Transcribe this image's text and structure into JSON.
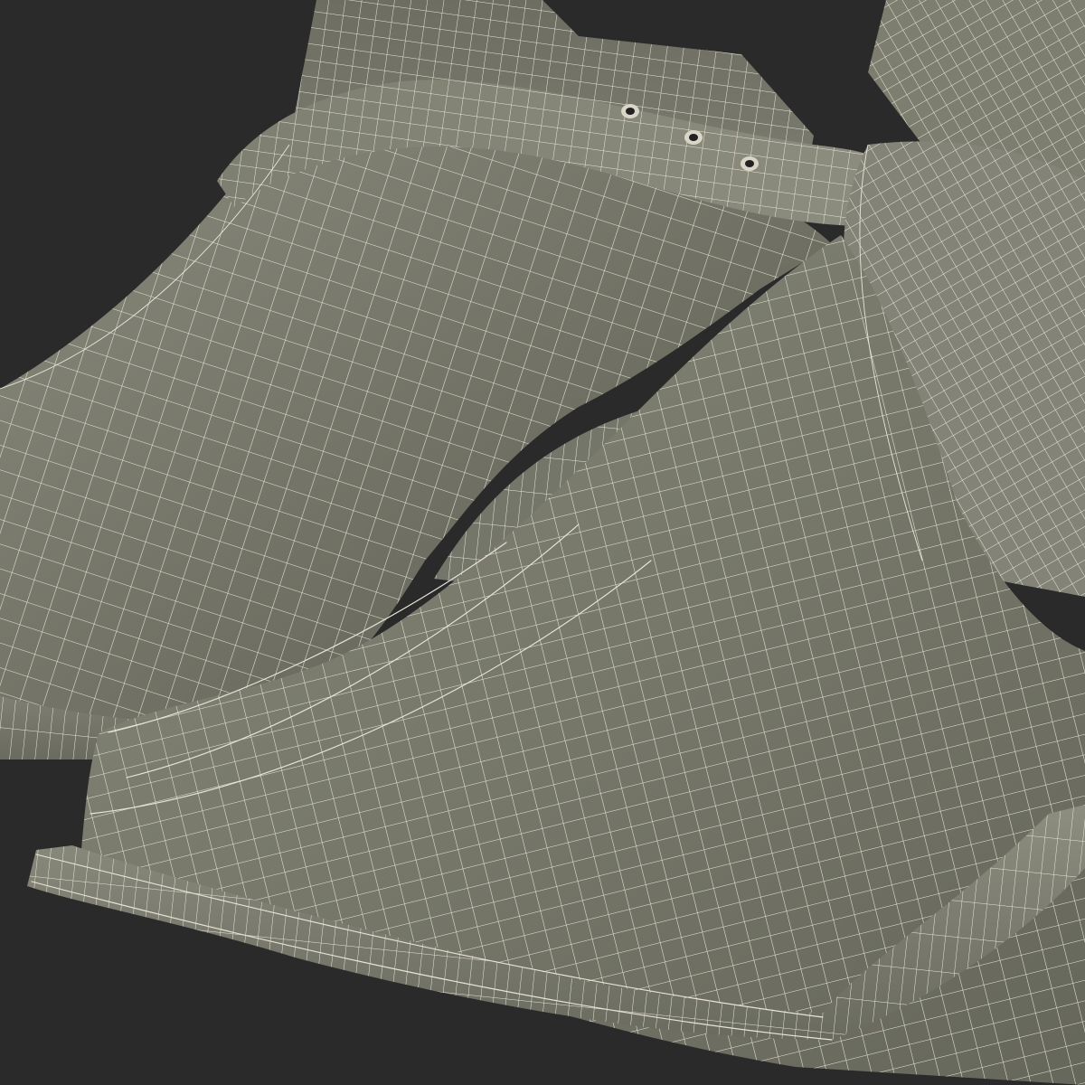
{
  "scene": {
    "background_color": "#2a2a2a",
    "surface_color": "#7a7b6d",
    "wire_color": "#e9e6d9",
    "objects": [
      "left-boot",
      "right-boot",
      "ankle-strap",
      "strap-holes",
      "sole-welts"
    ]
  }
}
